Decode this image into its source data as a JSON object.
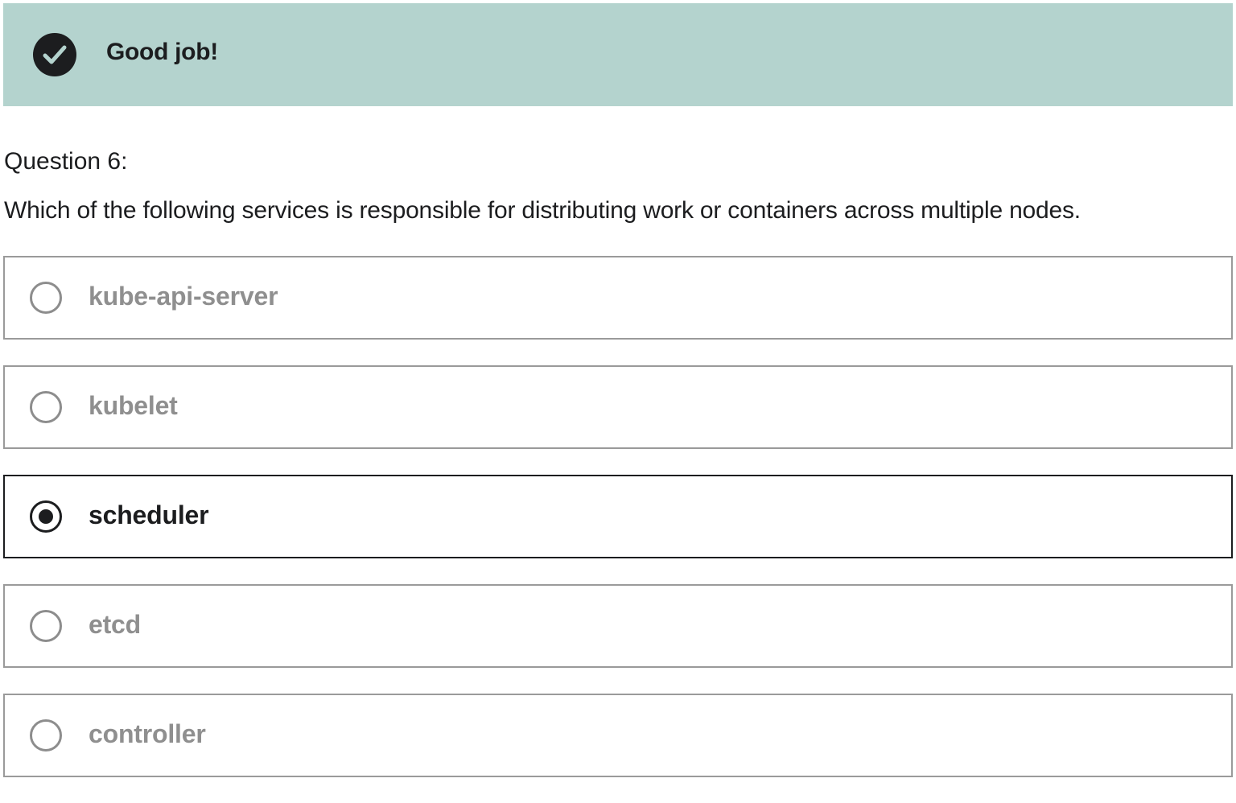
{
  "feedback": {
    "message": "Good job!",
    "icon": "check-circle-icon",
    "background_color": "#b4d3ce"
  },
  "question": {
    "number_label": "Question 6:",
    "prompt": "Which of the following services is responsible for distributing work or containers across multiple nodes."
  },
  "options": [
    {
      "label": "kube-api-server",
      "selected": false
    },
    {
      "label": "kubelet",
      "selected": false
    },
    {
      "label": "scheduler",
      "selected": true
    },
    {
      "label": "etcd",
      "selected": false
    },
    {
      "label": "controller",
      "selected": false
    }
  ],
  "colors": {
    "text_primary": "#1c1d1f",
    "text_muted": "#8f8f8f",
    "border_default": "#9a9a9a",
    "border_selected": "#1c1d1f"
  }
}
